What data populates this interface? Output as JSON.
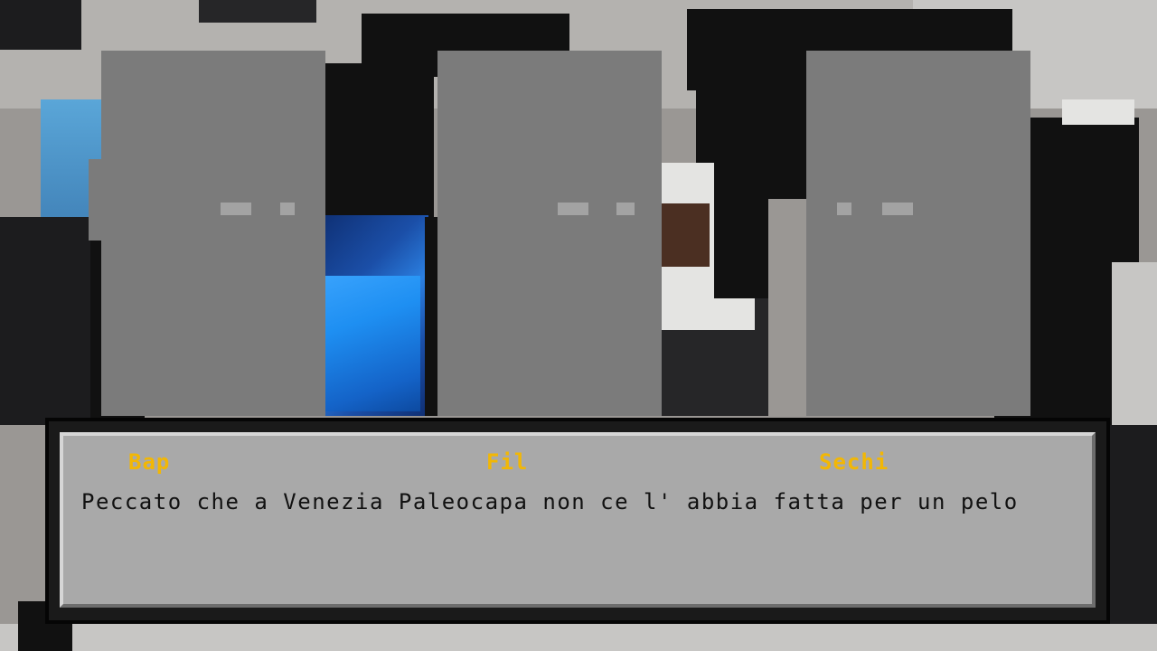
{
  "speakers": [
    {
      "name": "Bap"
    },
    {
      "name": "Fil"
    },
    {
      "name": "Sechi"
    }
  ],
  "dialogue": {
    "text": "Peccato che a Venezia Paleocapa non ce l' abbia fatta per un pelo"
  },
  "colors": {
    "speaker_name": "#f2b705",
    "dialog_background": "#a9a9a9",
    "dialog_text": "#111111",
    "character_placeholder": "#7b7b7b"
  }
}
